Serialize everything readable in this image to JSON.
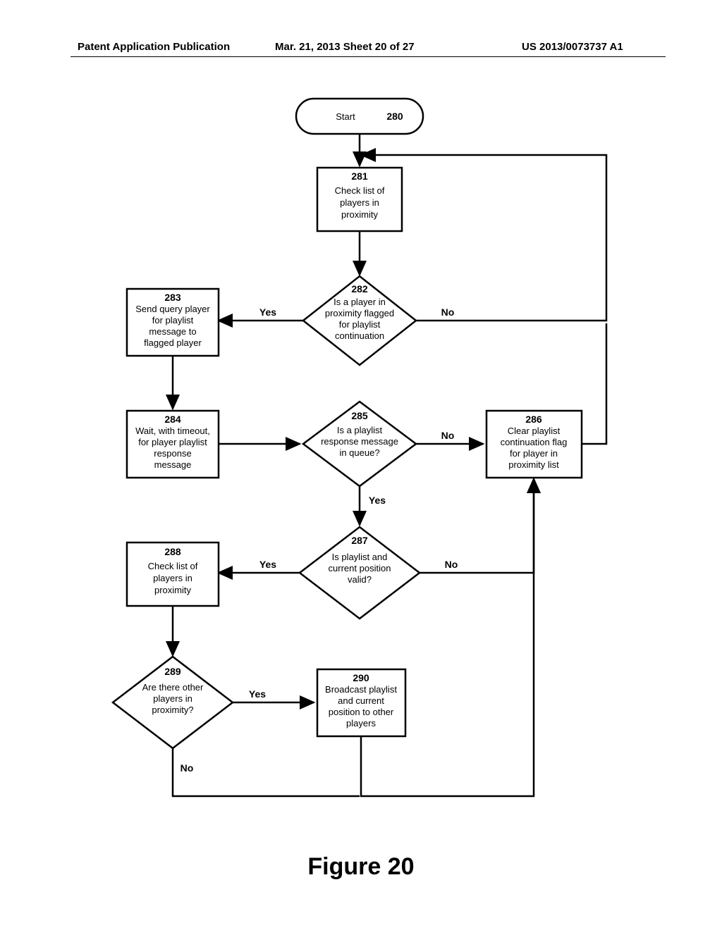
{
  "header": {
    "left": "Patent Application Publication",
    "mid": "Mar. 21, 2013  Sheet 20 of 27",
    "right": "US 2013/0073737 A1"
  },
  "figure_title": "Figure 20",
  "nodes": {
    "n280": {
      "num": "280",
      "text": "Start"
    },
    "n281": {
      "num": "281",
      "l1": "Check list of",
      "l2": "players in",
      "l3": "proximity"
    },
    "n282": {
      "num": "282",
      "l1": "Is a player in",
      "l2": "proximity flagged",
      "l3": "for playlist",
      "l4": "continuation"
    },
    "n283": {
      "num": "283",
      "l1": "Send query player",
      "l2": "for playlist",
      "l3": "message to",
      "l4": "flagged player"
    },
    "n284": {
      "num": "284",
      "l1": "Wait, with timeout,",
      "l2": "for player playlist",
      "l3": "response",
      "l4": "message"
    },
    "n285": {
      "num": "285",
      "l1": "Is a playlist",
      "l2": "response message",
      "l3": "in queue?"
    },
    "n286": {
      "num": "286",
      "l1": "Clear playlist",
      "l2": "continuation flag",
      "l3": "for player in",
      "l4": "proximity list"
    },
    "n287": {
      "num": "287",
      "l1": "Is playlist and",
      "l2": "current position",
      "l3": "valid?"
    },
    "n288": {
      "num": "288",
      "l1": "Check list of",
      "l2": "players in",
      "l3": "proximity"
    },
    "n289": {
      "num": "289",
      "l1": "Are there other",
      "l2": "players in",
      "l3": "proximity?"
    },
    "n290": {
      "num": "290",
      "l1": "Broadcast playlist",
      "l2": "and current",
      "l3": "position to other",
      "l4": "players"
    }
  },
  "edges": {
    "yes": "Yes",
    "no": "No"
  }
}
